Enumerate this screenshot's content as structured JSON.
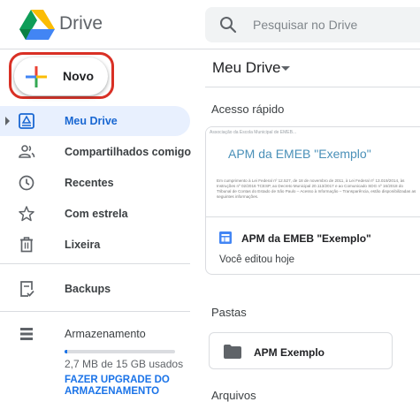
{
  "header": {
    "brand": "Drive",
    "search_placeholder": "Pesquisar no Drive"
  },
  "sidebar": {
    "new_button": "Novo",
    "items": [
      {
        "label": "Meu Drive",
        "icon": "drive-folder-icon",
        "active": true
      },
      {
        "label": "Compartilhados comigo",
        "icon": "people-icon"
      },
      {
        "label": "Recentes",
        "icon": "clock-icon"
      },
      {
        "label": "Com estrela",
        "icon": "star-icon"
      },
      {
        "label": "Lixeira",
        "icon": "trash-icon"
      },
      {
        "label": "Backups",
        "icon": "backup-icon"
      },
      {
        "label": "Armazenamento",
        "icon": "storage-icon"
      }
    ],
    "storage": {
      "used_text": "2,7 MB de 15 GB usados",
      "used_fraction": 0.02,
      "upgrade_label": "FAZER UPGRADE DO ARMAZENAMENTO"
    }
  },
  "main": {
    "title": "Meu Drive",
    "quick_access_label": "Acesso rápido",
    "quick_card": {
      "thumb_header": "Associação da Escola Municipal de EMEB...",
      "thumb_title": "APM da EMEB \"Exemplo\"",
      "thumb_body": "Em cumprimento à Lei Federal nº 12.527, de 18 de novembro de 2011, à Lei Federal nº 13.019/2014, às Instruções nº 02/2016 TCESP, ao Decreto Municipal 20.113/2017 e ao Comunicado SDG nº 16/2018 do Tribunal de Contas do Estado de São Paulo – Acesso à Informação – Transparência, estão disponibilizadas as seguintes informações.",
      "file_name": "APM da EMEB \"Exemplo\"",
      "subtitle": "Você editou hoje"
    },
    "folders_label": "Pastas",
    "folders": [
      {
        "name": "APM Exemplo"
      }
    ],
    "files_label": "Arquivos"
  },
  "colors": {
    "accent": "#1a73e8",
    "active_bg": "#e8f0fe",
    "highlight": "#d93025"
  }
}
